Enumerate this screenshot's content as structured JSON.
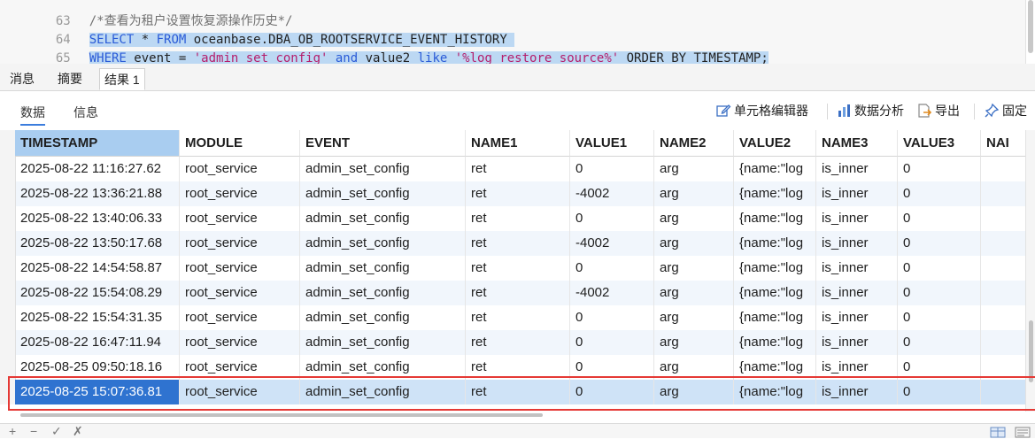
{
  "editor": {
    "lines": [
      {
        "num": "63",
        "comment": "/*查看为租户设置恢复源操作历史*/"
      },
      {
        "num": "64",
        "kw1": "SELECT",
        "text1": " * ",
        "kw2": "FROM",
        "text2": " oceanbase.DBA_OB_ROOTSERVICE_EVENT_HISTORY "
      },
      {
        "num": "65",
        "kw1": "WHERE",
        "text1": " event = ",
        "str1": "'admin_set_config'",
        "kw2": " and",
        "text2": " value2 ",
        "kw3": "like",
        "str2": " '%log_restore_source%'",
        "text3": " ORDER BY TIMESTAMP;"
      }
    ]
  },
  "result_tabs": [
    "消息",
    "摘要",
    "结果 1"
  ],
  "sub_tabs": [
    "数据",
    "信息"
  ],
  "toolbar": {
    "cell_editor": "单元格编辑器",
    "data_analysis": "数据分析",
    "export": "导出",
    "pin": "固定"
  },
  "grid": {
    "columns": [
      "TIMESTAMP",
      "MODULE",
      "EVENT",
      "NAME1",
      "VALUE1",
      "NAME2",
      "VALUE2",
      "NAME3",
      "VALUE3",
      "NAI"
    ],
    "rows": [
      [
        "2025-08-22 11:16:27.62",
        "root_service",
        "admin_set_config",
        "ret",
        "0",
        "arg",
        "{name:\"log",
        "is_inner",
        "0",
        ""
      ],
      [
        "2025-08-22 13:36:21.88",
        "root_service",
        "admin_set_config",
        "ret",
        "-4002",
        "arg",
        "{name:\"log",
        "is_inner",
        "0",
        ""
      ],
      [
        "2025-08-22 13:40:06.33",
        "root_service",
        "admin_set_config",
        "ret",
        "0",
        "arg",
        "{name:\"log",
        "is_inner",
        "0",
        ""
      ],
      [
        "2025-08-22 13:50:17.68",
        "root_service",
        "admin_set_config",
        "ret",
        "-4002",
        "arg",
        "{name:\"log",
        "is_inner",
        "0",
        ""
      ],
      [
        "2025-08-22 14:54:58.87",
        "root_service",
        "admin_set_config",
        "ret",
        "0",
        "arg",
        "{name:\"log",
        "is_inner",
        "0",
        ""
      ],
      [
        "2025-08-22 15:54:08.29",
        "root_service",
        "admin_set_config",
        "ret",
        "-4002",
        "arg",
        "{name:\"log",
        "is_inner",
        "0",
        ""
      ],
      [
        "2025-08-22 15:54:31.35",
        "root_service",
        "admin_set_config",
        "ret",
        "0",
        "arg",
        "{name:\"log",
        "is_inner",
        "0",
        ""
      ],
      [
        "2025-08-22 16:47:11.94",
        "root_service",
        "admin_set_config",
        "ret",
        "0",
        "arg",
        "{name:\"log",
        "is_inner",
        "0",
        ""
      ],
      [
        "2025-08-25 09:50:18.16",
        "root_service",
        "admin_set_config",
        "ret",
        "0",
        "arg",
        "{name:\"log",
        "is_inner",
        "0",
        ""
      ],
      [
        "2025-08-25 15:07:36.81",
        "root_service",
        "admin_set_config",
        "ret",
        "0",
        "arg",
        "{name:\"log",
        "is_inner",
        "0",
        ""
      ]
    ],
    "selected_row": 9
  },
  "bottom_bar": {
    "add": "+",
    "remove": "−",
    "apply": "✓",
    "cancel": "✗"
  },
  "colors": {
    "accent": "#2f73d0",
    "selection": "#bcd8f3",
    "highlight_box": "#e53935"
  }
}
